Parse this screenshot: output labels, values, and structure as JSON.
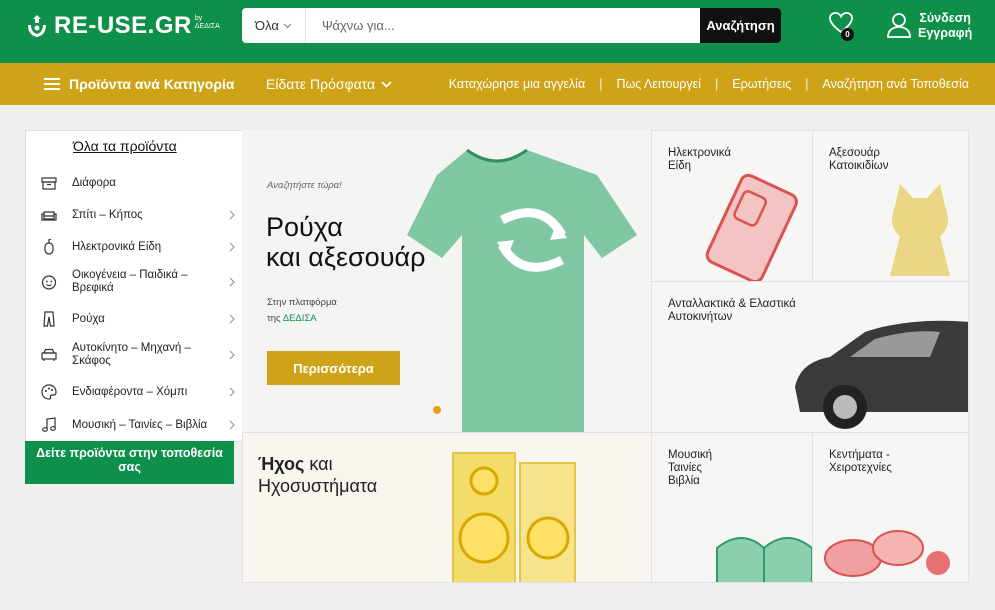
{
  "header": {
    "logo_text": "RE-USE.GR",
    "logo_sub_1": "by",
    "logo_sub_2": "ΔΕΔΙΣΑ",
    "search_category": "Όλα",
    "search_placeholder": "Ψάχνω για...",
    "search_button": "Αναζήτηση",
    "favorites_count": "0",
    "login_label": "Σύνδεση",
    "register_label": "Εγγραφή"
  },
  "navbar": {
    "categories_label": "Προϊόντα ανά Κατηγορία",
    "recent_label": "Είδατε Πρόσφατα",
    "links": [
      "Καταχώρησε μια αγγελία",
      "Πως Λειτουργεί",
      "Ερωτήσεις",
      "Αναζήτηση ανά Τοποθεσία"
    ]
  },
  "sidebar": {
    "heading": "Όλα τα προϊόντα",
    "items": [
      {
        "label": "Διάφορα",
        "icon": "box-icon",
        "has_children": false
      },
      {
        "label": "Σπίτι – Κήπος",
        "icon": "sofa-icon",
        "has_children": true
      },
      {
        "label": "Ηλεκτρονικά Είδη",
        "icon": "mouse-icon",
        "has_children": true
      },
      {
        "label": "Οικογένεια – Παιδικά – Βρεφικά",
        "icon": "baby-face-icon",
        "has_children": true
      },
      {
        "label": "Ρούχα",
        "icon": "trousers-icon",
        "has_children": true
      },
      {
        "label": "Αυτοκίνητο – Μηχανή – Σκάφος",
        "icon": "car-icon",
        "has_children": true
      },
      {
        "label": "Ενδιαφέροντα – Χόμπι",
        "icon": "palette-icon",
        "has_children": true
      },
      {
        "label": "Μουσική – Ταινίες – Βιβλία",
        "icon": "music-note-icon",
        "has_children": true
      }
    ],
    "location_button": "Δείτε προϊόντα στην τοποθεσία σας"
  },
  "hero": {
    "kicker": "Αναζητήστε τώρα!",
    "title_line1": "Ρούχα",
    "title_line2": "και αξεσουάρ",
    "platform_text": "Στην πλατφόρμα",
    "platform_prefix": "της ",
    "platform_name": "ΔΕΔΙΣΑ",
    "button": "Περισσότερα"
  },
  "tiles": {
    "electronics": [
      "Ηλεκτρονικά",
      "Είδη"
    ],
    "pets": [
      "Αξεσουάρ",
      "Κατοικιδίων"
    ],
    "auto": [
      "Ανταλλακτικά & Ελαστικά",
      "Αυτοκινήτων"
    ],
    "sound_bold": "Ήχος",
    "sound_rest": " και",
    "sound_line2": "Ηχοσυστήματα",
    "music": [
      "Μουσική",
      "Ταινίες",
      "Βιβλία"
    ],
    "crafts": [
      "Κεντήματα -",
      "Χειροτεχνίες"
    ]
  },
  "colors": {
    "brand_green": "#0e8f4a",
    "brand_gold": "#cfa318"
  }
}
